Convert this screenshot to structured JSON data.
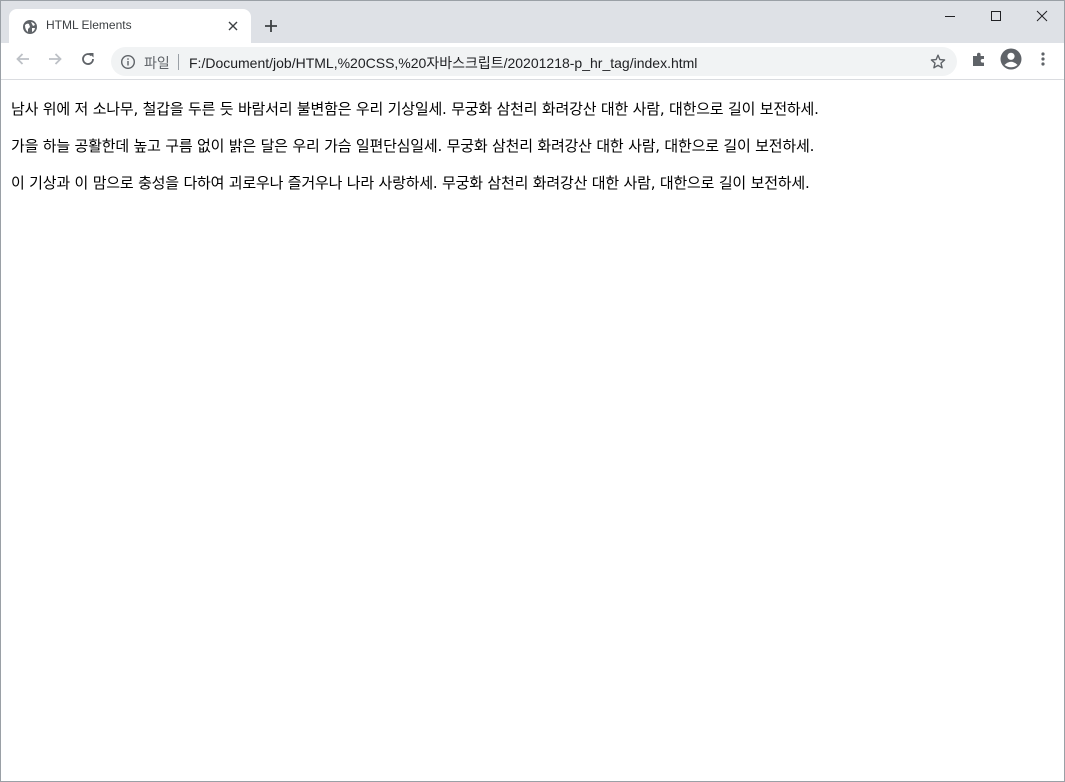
{
  "tab": {
    "title": "HTML Elements",
    "favicon": "globe-icon",
    "close_icon": "close-icon"
  },
  "new_tab_icon": "plus-icon",
  "window_controls": {
    "minimize_icon": "minimize-icon",
    "maximize_icon": "maximize-icon",
    "close_icon": "close-icon"
  },
  "toolbar": {
    "back_icon": "arrow-left-icon",
    "forward_icon": "arrow-right-icon",
    "reload_icon": "reload-icon",
    "extensions_icon": "puzzle-icon",
    "profile_icon": "account-icon",
    "menu_icon": "more-vert-icon"
  },
  "omnibox": {
    "info_icon": "info-icon",
    "scheme_label": "파일",
    "url": "F:/Document/job/HTML,%20CSS,%20자바스크립트/20201218-p_hr_tag/index.html",
    "bookmark_icon": "star-icon"
  },
  "colors": {
    "tabstrip": "#dee1e6",
    "omnibox": "#f1f3f4",
    "text": "#000000"
  },
  "page": {
    "paragraphs": [
      "남사 위에 저 소나무, 철갑을 두른 듯 바람서리 불변함은 우리 기상일세. 무궁화 삼천리 화려강산 대한 사람, 대한으로 길이 보전하세.",
      "가을 하늘 공활한데 높고 구름 없이 밝은 달은 우리 가슴 일편단심일세. 무궁화 삼천리 화려강산 대한 사람, 대한으로 길이 보전하세.",
      "이 기상과 이 맘으로 충성을 다하여 괴로우나 즐거우나 나라 사랑하세. 무궁화 삼천리 화려강산 대한 사람, 대한으로 길이 보전하세."
    ]
  }
}
